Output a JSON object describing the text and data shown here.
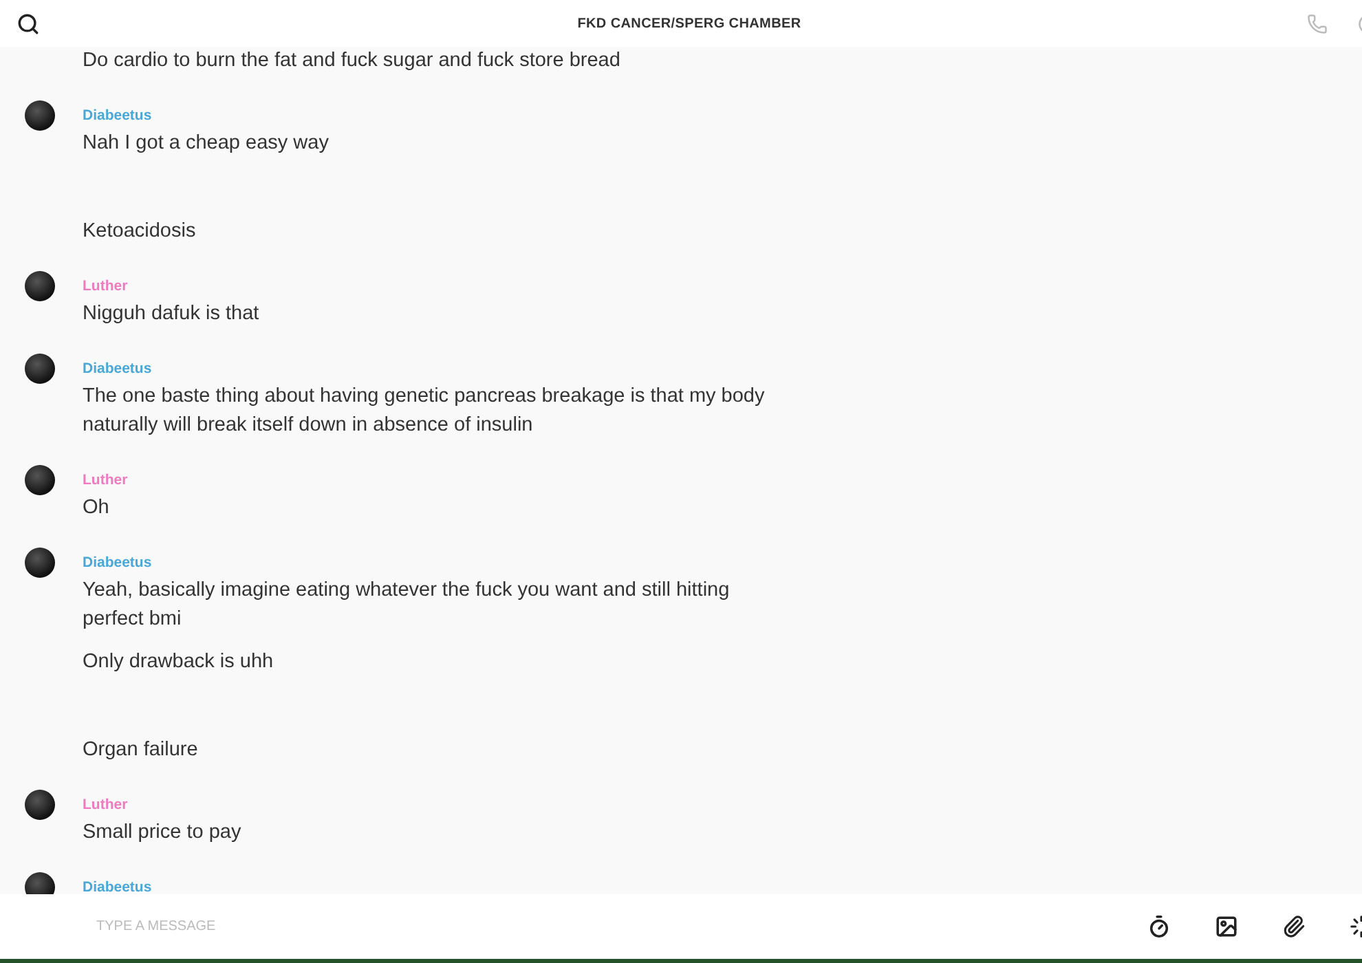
{
  "header": {
    "title": "FKD CANCER/SPERG CHAMBER"
  },
  "groups": [
    {
      "messages": [
        {
          "kind": "text",
          "text": "Do cardio to burn the fat and fuck sugar and fuck store bread"
        }
      ]
    },
    {
      "sender": "Diabeetus",
      "color": "#4aa8d8",
      "messages": [
        {
          "kind": "text",
          "text": "Nah I got a cheap easy way"
        },
        {
          "kind": "spaced",
          "text": "Ketoacidosis"
        }
      ]
    },
    {
      "sender": "Luther",
      "color": "#f07ac0",
      "messages": [
        {
          "kind": "text",
          "text": "Nigguh dafuk is that"
        }
      ]
    },
    {
      "sender": "Diabeetus",
      "color": "#4aa8d8",
      "messages": [
        {
          "kind": "text",
          "text": "The one baste thing about having genetic pancreas breakage is that my body naturally will break itself down in absence of insulin"
        }
      ]
    },
    {
      "sender": "Luther",
      "color": "#f07ac0",
      "messages": [
        {
          "kind": "text",
          "text": "Oh"
        }
      ]
    },
    {
      "sender": "Diabeetus",
      "color": "#4aa8d8",
      "messages": [
        {
          "kind": "text",
          "text": "Yeah, basically imagine eating whatever the fuck you want and still hitting perfect bmi"
        },
        {
          "kind": "text",
          "text": "Only drawback is uhh"
        },
        {
          "kind": "spaced",
          "text": "Organ failure"
        }
      ]
    },
    {
      "sender": "Luther",
      "color": "#f07ac0",
      "messages": [
        {
          "kind": "text",
          "text": "Small price to pay"
        }
      ]
    },
    {
      "sender": "Diabeetus",
      "color": "#4aa8d8"
    }
  ],
  "composer": {
    "placeholder": "TYPE A MESSAGE"
  }
}
